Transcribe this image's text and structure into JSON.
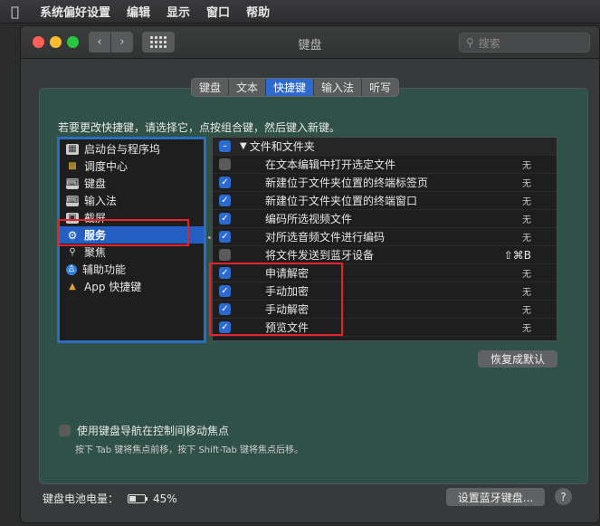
{
  "menubar": {
    "app": "系统偏好设置",
    "items": [
      "编辑",
      "显示",
      "窗口",
      "帮助"
    ]
  },
  "window": {
    "title": "键盘",
    "search_placeholder": "搜索"
  },
  "tabs": [
    {
      "label": "键盘",
      "active": false
    },
    {
      "label": "文本",
      "active": false
    },
    {
      "label": "快捷键",
      "active": true
    },
    {
      "label": "输入法",
      "active": false
    },
    {
      "label": "听写",
      "active": false
    }
  ],
  "instruction": "若要更改快捷键，请选择它，点按组合键，然后键入新键。",
  "categories": [
    {
      "label": "启动台与程序坞",
      "icon": "launchpad-icon",
      "selected": false
    },
    {
      "label": "调度中心",
      "icon": "mission-control-icon",
      "selected": false
    },
    {
      "label": "键盘",
      "icon": "keyboard-icon",
      "selected": false
    },
    {
      "label": "输入法",
      "icon": "keyboard-icon",
      "selected": false
    },
    {
      "label": "截屏",
      "icon": "screenshot-icon",
      "selected": false
    },
    {
      "label": "服务",
      "icon": "gear-icon",
      "selected": true
    },
    {
      "label": "聚焦",
      "icon": "spotlight-icon",
      "selected": false
    },
    {
      "label": "辅助功能",
      "icon": "accessibility-icon",
      "selected": false
    },
    {
      "label": "App 快捷键",
      "icon": "app-store-icon",
      "selected": false
    }
  ],
  "shortcuts": {
    "group": "文件和文件夹",
    "rows": [
      {
        "label": "在文本编辑中打开选定文件",
        "checked": false,
        "key": "无"
      },
      {
        "label": "新建位于文件夹位置的终端标签页",
        "checked": true,
        "key": "无"
      },
      {
        "label": "新建位于文件夹位置的终端窗口",
        "checked": true,
        "key": "无"
      },
      {
        "label": "编码所选视频文件",
        "checked": true,
        "key": "无"
      },
      {
        "label": "对所选音频文件进行编码",
        "checked": true,
        "key": "无"
      },
      {
        "label": "将文件发送到蓝牙设备",
        "checked": false,
        "key": "⇧⌘B"
      },
      {
        "label": "申请解密",
        "checked": true,
        "key": "无"
      },
      {
        "label": "手动加密",
        "checked": true,
        "key": "无"
      },
      {
        "label": "手动解密",
        "checked": true,
        "key": "无"
      },
      {
        "label": "预览文件",
        "checked": true,
        "key": "无"
      }
    ]
  },
  "restore_button": "恢复成默认",
  "keyboard_navigation": {
    "label": "使用键盘导航在控制间移动焦点",
    "hint": "按下 Tab 键将焦点前移，按下 Shift-Tab 键将焦点后移。",
    "checked": false
  },
  "battery": {
    "label": "键盘电池电量：",
    "percent": "45%",
    "level": 0.45
  },
  "bluetooth_button": "设置蓝牙键盘...",
  "help_label": "?",
  "colors": {
    "accent": "#2d6ad0",
    "annotation_red": "#e3242b"
  }
}
